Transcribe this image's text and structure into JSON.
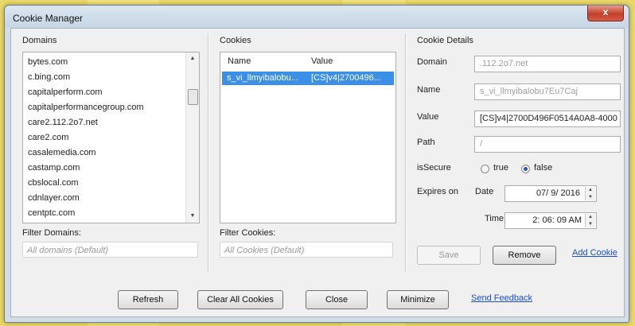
{
  "window": {
    "title": "Cookie Manager",
    "close_glyph": "x"
  },
  "domains": {
    "group_label": "Domains",
    "items": [
      "bytes.com",
      "c.bing.com",
      "capitalperform.com",
      "capitalperformancegroup.com",
      "care2.112.2o7.net",
      "care2.com",
      "casalemedia.com",
      "castamp.com",
      "cbslocal.com",
      "cdnlayer.com",
      "centptc.com"
    ],
    "filter_label": "Filter Domains:",
    "filter_placeholder": "All domains (Default)"
  },
  "cookies": {
    "group_label": "Cookies",
    "columns": [
      "Name",
      "Value"
    ],
    "rows": [
      {
        "name": "s_vi_llmyibalobu...",
        "value": "[CS]v4|2700496..."
      }
    ],
    "filter_label": "Filter Cookies:",
    "filter_placeholder": "All Cookies (Default)"
  },
  "details": {
    "group_label": "Cookie Details",
    "domain_label": "Domain",
    "domain_value": ".112.2o7.net",
    "name_label": "Name",
    "name_value": "s_vi_llmyibalobu7Eu7Caj",
    "value_label": "Value",
    "value_value": "[CS]v4|2700D496F0514A0A8-4000",
    "path_label": "Path",
    "path_value": "/",
    "issecure_label": "isSecure",
    "true_label": "true",
    "false_label": "false",
    "issecure_selected": "false",
    "expires_label": "Expires on",
    "date_label": "Date",
    "date_value": "07/ 9/ 2016",
    "time_label": "Time",
    "time_value": "2: 06: 09 AM",
    "save_label": "Save",
    "remove_label": "Remove",
    "add_cookie_label": "Add Cookie"
  },
  "bottom": {
    "refresh_label": "Refresh",
    "clear_all_label": "Clear All Cookies",
    "close_label": "Close",
    "minimize_label": "Minimize",
    "feedback_label": "Send Feedback"
  }
}
